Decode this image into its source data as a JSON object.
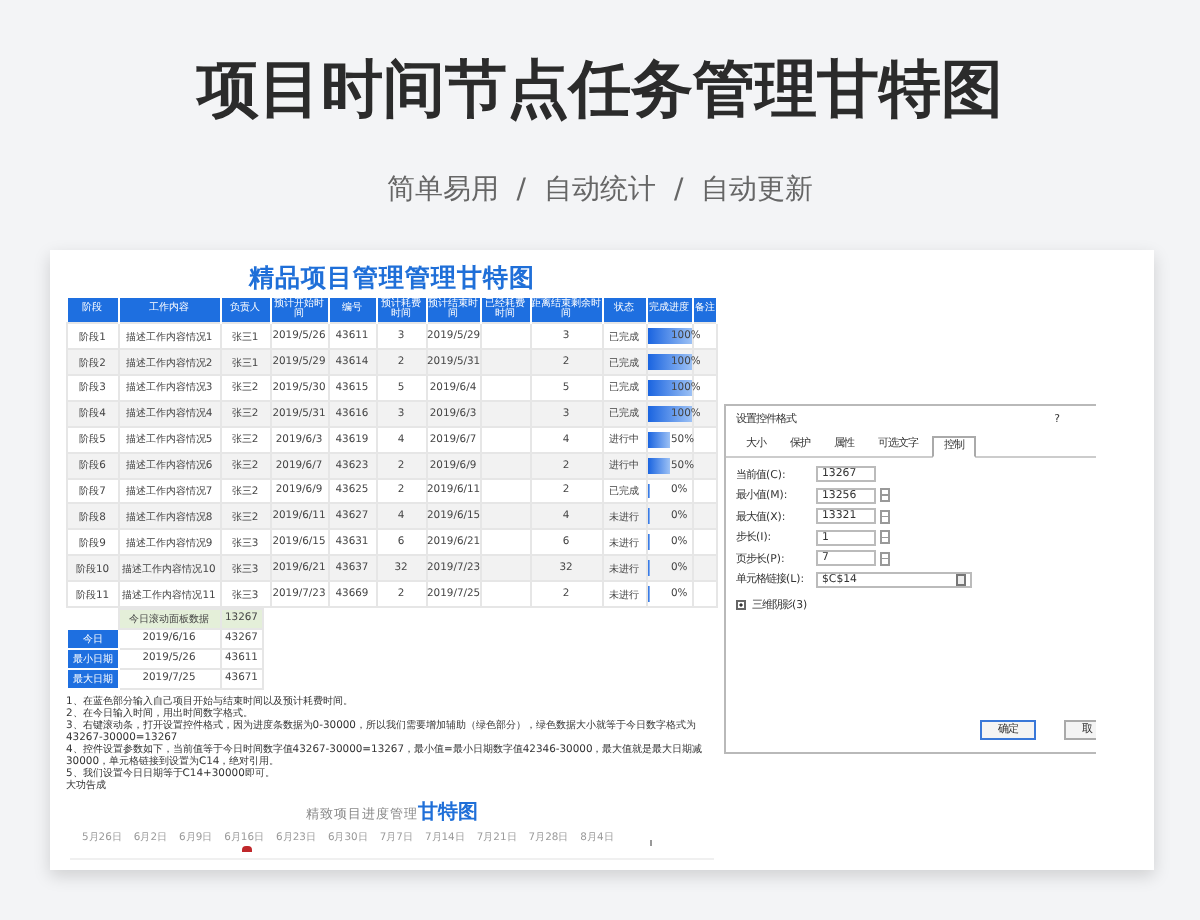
{
  "title": "项目时间节点任务管理甘特图",
  "subtitle": [
    "简单易用",
    "/",
    "自动统计",
    "/",
    "自动更新"
  ],
  "sheet": {
    "title": "精品项目管理管理甘特图",
    "columns": [
      "阶段",
      "工作内容",
      "负责人",
      "预计开始时间",
      "编号",
      "预计耗费时间",
      "预计结束时间",
      "已经耗费时间",
      "距离结束剩余时间",
      "状态",
      "完成进度",
      "备注"
    ],
    "rows": [
      {
        "cells": [
          "阶段1",
          "描述工作内容情况1",
          "张三1",
          "2019/5/26",
          "43611",
          "3",
          "2019/5/29",
          "",
          "3",
          "已完成"
        ],
        "progress": "100%",
        "level": 1
      },
      {
        "cells": [
          "阶段2",
          "描述工作内容情况2",
          "张三1",
          "2019/5/29",
          "43614",
          "2",
          "2019/5/31",
          "",
          "2",
          "已完成"
        ],
        "progress": "100%",
        "level": 1
      },
      {
        "cells": [
          "阶段3",
          "描述工作内容情况3",
          "张三2",
          "2019/5/30",
          "43615",
          "5",
          "2019/6/4",
          "",
          "5",
          "已完成"
        ],
        "progress": "100%",
        "level": 1
      },
      {
        "cells": [
          "阶段4",
          "描述工作内容情况4",
          "张三2",
          "2019/5/31",
          "43616",
          "3",
          "2019/6/3",
          "",
          "3",
          "已完成"
        ],
        "progress": "100%",
        "level": 1
      },
      {
        "cells": [
          "阶段5",
          "描述工作内容情况5",
          "张三2",
          "2019/6/3",
          "43619",
          "4",
          "2019/6/7",
          "",
          "4",
          "进行中"
        ],
        "progress": "50%",
        "level": 0.5
      },
      {
        "cells": [
          "阶段6",
          "描述工作内容情况6",
          "张三2",
          "2019/6/7",
          "43623",
          "2",
          "2019/6/9",
          "",
          "2",
          "进行中"
        ],
        "progress": "50%",
        "level": 0.5
      },
      {
        "cells": [
          "阶段7",
          "描述工作内容情况7",
          "张三2",
          "2019/6/9",
          "43625",
          "2",
          "2019/6/11",
          "",
          "2",
          "已完成"
        ],
        "progress": "0%",
        "level": 0.05
      },
      {
        "cells": [
          "阶段8",
          "描述工作内容情况8",
          "张三2",
          "2019/6/11",
          "43627",
          "4",
          "2019/6/15",
          "",
          "4",
          "未进行"
        ],
        "progress": "0%",
        "level": 0.05
      },
      {
        "cells": [
          "阶段9",
          "描述工作内容情况9",
          "张三3",
          "2019/6/15",
          "43631",
          "6",
          "2019/6/21",
          "",
          "6",
          "未进行"
        ],
        "progress": "0%",
        "level": 0.05
      },
      {
        "cells": [
          "阶段10",
          "描述工作内容情况10",
          "张三3",
          "2019/6/21",
          "43637",
          "32",
          "2019/7/23",
          "",
          "32",
          "未进行"
        ],
        "progress": "0%",
        "level": 0.05
      },
      {
        "cells": [
          "阶段11",
          "描述工作内容情况11",
          "张三3",
          "2019/7/23",
          "43669",
          "2",
          "2019/7/25",
          "",
          "2",
          "未进行"
        ],
        "progress": "0%",
        "level": 0.05
      }
    ],
    "summary": {
      "header": [
        "今日滚动面板数据",
        "13267"
      ],
      "rows": [
        [
          "今日",
          "2019/6/16",
          "43267"
        ],
        [
          "最小日期",
          "2019/5/26",
          "43611"
        ],
        [
          "最大日期",
          "2019/7/25",
          "43671"
        ]
      ]
    },
    "notes": [
      "1、在蓝色部分输入自己项目开始与结束时间以及预计耗费时间。",
      "2、在今日输入时间，用出时间数字格式。",
      "3、右键滚动条，打开设置控件格式，因为进度条数据为0-30000，所以我们需要增加辅助（绿色部分），绿色数据大小就等于今日数字格式为43267-30000=13267",
      "4、控件设置参数如下，当前值等于今日时间数字值43267-30000=13267，最小值=最小日期数字值42346-30000，最大值就是最大日期减30000，单元格链接到设置为C14，绝对引用。",
      "5、我们设置今日日期等于C14+30000即可。",
      "大功告成"
    ],
    "gantt": {
      "title": "精致项目进度管理**甘特图**",
      "axis": [
        "5月26日",
        "6月2日",
        "6月9日",
        "6月16日",
        "6月23日",
        "6月30日",
        "7月7日",
        "7月14日",
        "7月21日",
        "7月28日",
        "8月4日"
      ]
    }
  },
  "dialog": {
    "title": "设置控件格式",
    "help": "?",
    "tabs": [
      {
        "label": "大小",
        "selected": false
      },
      {
        "label": "保护",
        "selected": false
      },
      {
        "label": "属性",
        "selected": false
      },
      {
        "label": "可选文字",
        "selected": false
      },
      {
        "label": "控制",
        "selected": true
      }
    ],
    "fields": [
      {
        "label": "当前值(C):",
        "value": "13267",
        "kind": "plain"
      },
      {
        "label": "最小值(M):",
        "value": "13256",
        "kind": "spin"
      },
      {
        "label": "最大值(X):",
        "value": "13321",
        "kind": "spin"
      },
      {
        "label": "步长(I):",
        "value": "1",
        "kind": "spin"
      },
      {
        "label": "页步长(P):",
        "value": "7",
        "kind": "spin"
      },
      {
        "label": "单元格链接(L):",
        "value": "$C$14",
        "kind": "ref"
      }
    ],
    "checkbox": {
      "label": "三维阴影(3)",
      "checked": true
    },
    "buttons": [
      "确定",
      "取"
    ]
  }
}
